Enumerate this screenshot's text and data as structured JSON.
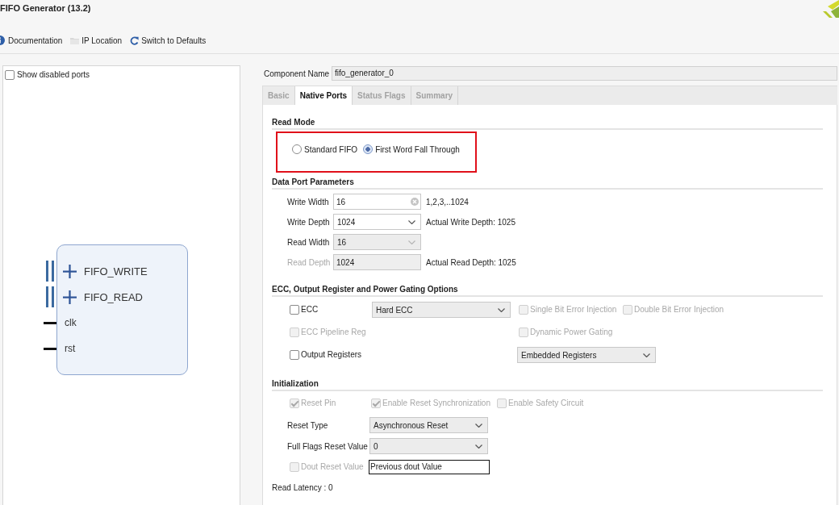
{
  "window": {
    "title": "FIFO Generator (13.2)"
  },
  "toolbar": [
    {
      "kind": "info",
      "label": "Documentation"
    },
    {
      "kind": "folder",
      "label": "IP Location"
    },
    {
      "kind": "refresh",
      "label": "Switch to Defaults"
    }
  ],
  "symbol_panel": {
    "show_disabled_ports": {
      "label": "Show disabled ports",
      "checked": false
    },
    "ports": [
      {
        "name": "FIFO_WRITE",
        "kind": "bus"
      },
      {
        "name": "FIFO_READ",
        "kind": "bus"
      },
      {
        "name": "clk",
        "kind": "wire"
      },
      {
        "name": "rst",
        "kind": "wire"
      }
    ]
  },
  "component_name": {
    "label": "Component Name",
    "value": "fifo_generator_0"
  },
  "tabs": [
    {
      "label": "Basic",
      "selected": false
    },
    {
      "label": "Native Ports",
      "selected": true
    },
    {
      "label": "Status Flags",
      "selected": false
    },
    {
      "label": "Summary",
      "selected": false
    }
  ],
  "read_mode": {
    "title": "Read Mode",
    "highlighted": true,
    "options": [
      {
        "label": "Standard FIFO",
        "selected": false
      },
      {
        "label": "First Word Fall Through",
        "selected": true
      }
    ]
  },
  "data_port_parameters": {
    "title": "Data Port Parameters",
    "rows": [
      {
        "label": "Write Width",
        "label_disabled": false,
        "kind": "text",
        "value": "16",
        "disabled": false,
        "note": "1,2,3,..1024"
      },
      {
        "label": "Write Depth",
        "label_disabled": false,
        "kind": "combo",
        "value": "1024",
        "disabled": false,
        "note": "Actual Write Depth: 1025"
      },
      {
        "label": "Read Width",
        "label_disabled": false,
        "kind": "dropdown",
        "value": "16",
        "disabled": true
      },
      {
        "label": "Read Depth",
        "label_disabled": true,
        "kind": "text",
        "value": "1024",
        "disabled": true,
        "note": "Actual Read Depth: 1025"
      }
    ]
  },
  "ecc_section": {
    "title": "ECC, Output Register and Power Gating Options",
    "ecc": {
      "label": "ECC",
      "checked": false,
      "disabled": false
    },
    "ecc_type": {
      "value": "Hard ECC"
    },
    "single_bit_error_injection": {
      "label": "Single Bit Error Injection",
      "checked": false,
      "disabled": true
    },
    "double_bit_error_injection": {
      "label": "Double Bit Error Injection",
      "checked": false,
      "disabled": true
    },
    "ecc_pipeline_reg": {
      "label": "ECC Pipeline Reg",
      "checked": false,
      "disabled": true
    },
    "dynamic_power_gating": {
      "label": "Dynamic Power Gating",
      "checked": false,
      "disabled": true
    },
    "output_registers": {
      "label": "Output Registers",
      "checked": false,
      "disabled": false
    },
    "output_register_type": {
      "value": "Embedded Registers"
    }
  },
  "initialization": {
    "title": "Initialization",
    "reset_pin": {
      "label": "Reset Pin",
      "checked": true,
      "disabled": true
    },
    "enable_reset_synchronization": {
      "label": "Enable Reset Synchronization",
      "checked": true,
      "disabled": true
    },
    "enable_safety_circuit": {
      "label": "Enable Safety Circuit",
      "checked": false,
      "disabled": true
    },
    "reset_type": {
      "label": "Reset Type",
      "value": "Asynchronous Reset"
    },
    "full_flags_reset_value": {
      "label": "Full Flags Reset Value",
      "value": "0"
    },
    "dout_reset_value": {
      "label": "Dout Reset Value",
      "checked": false,
      "disabled": true,
      "value": "Previous dout Value"
    }
  },
  "read_latency": "Read Latency : 0"
}
